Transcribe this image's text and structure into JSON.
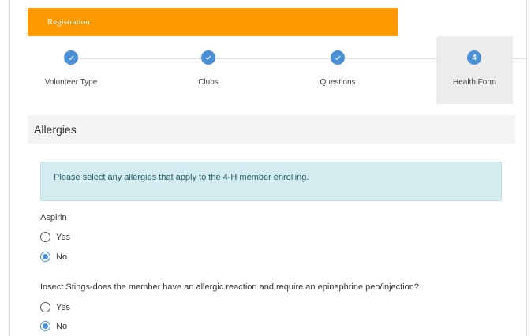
{
  "header": {
    "title": "Registration"
  },
  "steps": [
    {
      "label": "Volunteer Type",
      "status": "complete",
      "number": ""
    },
    {
      "label": "Clubs",
      "status": "complete",
      "number": ""
    },
    {
      "label": "Questions",
      "status": "complete",
      "number": ""
    },
    {
      "label": "Health Form",
      "status": "active",
      "number": "4"
    }
  ],
  "section": {
    "title": "Allergies"
  },
  "info": {
    "text": "Please select any allergies that apply to the 4-H member enrolling."
  },
  "questions": [
    {
      "label": "Aspirin",
      "options": [
        {
          "label": "Yes",
          "checked": false
        },
        {
          "label": "No",
          "checked": true
        }
      ]
    },
    {
      "label": "Insect Stings-does the member have an allergic reaction and require an epinephrine pen/injection?",
      "options": [
        {
          "label": "Yes",
          "checked": false
        },
        {
          "label": "No",
          "checked": true
        }
      ]
    }
  ],
  "colors": {
    "header": "#ff9900",
    "accent": "#4a90d6",
    "info_bg": "#d3ecef"
  },
  "icons": {
    "complete_step": "check-icon"
  }
}
